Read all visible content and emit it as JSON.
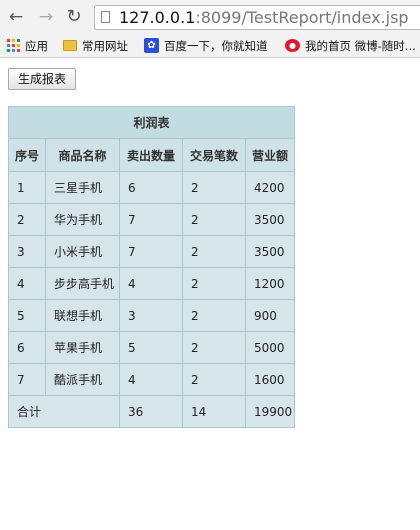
{
  "browser": {
    "url_host": "127.0.0.1",
    "url_rest": ":8099/TestReport/index.jsp",
    "bookmarks": [
      {
        "label": "应用",
        "icon": "apps-grid-icon"
      },
      {
        "label": "常用网址",
        "icon": "folder-icon"
      },
      {
        "label": "百度一下，你就知道",
        "icon": "baidu-paw-icon"
      },
      {
        "label": "我的首页 微博-随时...",
        "icon": "weibo-icon"
      }
    ]
  },
  "page": {
    "generate_button": "生成报表",
    "table": {
      "caption": "利润表",
      "columns": [
        "序号",
        "商品名称",
        "卖出数量",
        "交易笔数",
        "营业额"
      ],
      "rows": [
        [
          "1",
          "三星手机",
          "6",
          "2",
          "4200"
        ],
        [
          "2",
          "华为手机",
          "7",
          "2",
          "3500"
        ],
        [
          "3",
          "小米手机",
          "7",
          "2",
          "3500"
        ],
        [
          "4",
          "步步高手机",
          "4",
          "2",
          "1200"
        ],
        [
          "5",
          "联想手机",
          "3",
          "2",
          "900"
        ],
        [
          "6",
          "苹果手机",
          "5",
          "2",
          "5000"
        ],
        [
          "7",
          "酷派手机",
          "4",
          "2",
          "1600"
        ]
      ],
      "total": {
        "label": "合计",
        "qty": "36",
        "trades": "14",
        "revenue": "19900"
      }
    }
  }
}
